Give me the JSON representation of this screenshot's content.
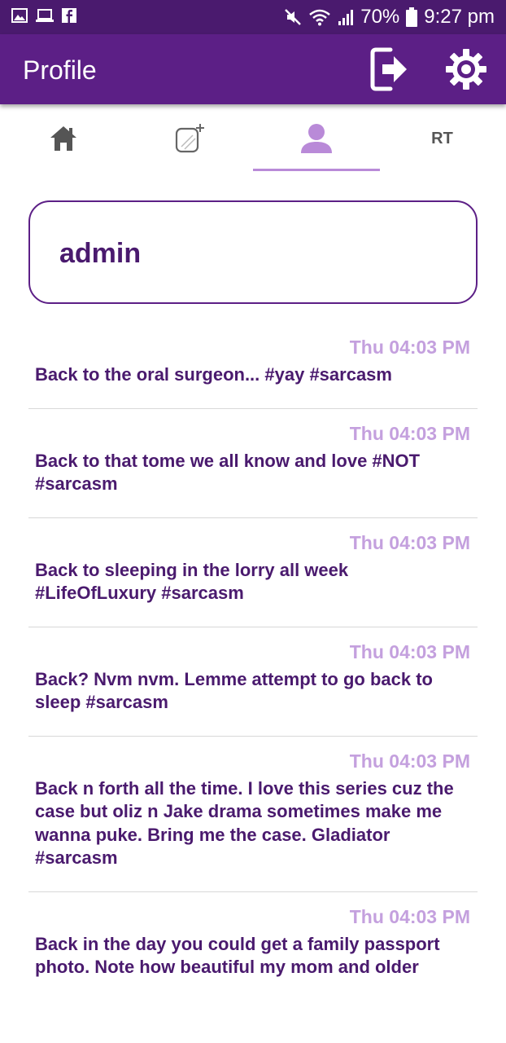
{
  "status_bar": {
    "battery": "70%",
    "time": "9:27 pm",
    "icons": [
      "gallery-icon",
      "laptop-icon",
      "facebook-icon",
      "mute-icon",
      "wifi-icon",
      "signal-icon",
      "battery-icon"
    ]
  },
  "app_bar": {
    "title": "Profile",
    "actions": [
      "logout-icon",
      "settings-icon"
    ]
  },
  "tabs": [
    {
      "icon": "home-icon"
    },
    {
      "icon": "new-post-icon"
    },
    {
      "icon": "profile-icon",
      "active": true
    },
    {
      "label": "RT"
    }
  ],
  "profile": {
    "username": "admin"
  },
  "posts": [
    {
      "time": "Thu 04:03 PM",
      "text": "Back to the oral surgeon... #yay #sarcasm"
    },
    {
      "time": "Thu 04:03 PM",
      "text": "Back to that tome we all know and love #NOT #sarcasm"
    },
    {
      "time": "Thu 04:03 PM",
      "text": "Back to sleeping in the lorry all week #LifeOfLuxury #sarcasm"
    },
    {
      "time": "Thu 04:03 PM",
      "text": "Back? Nvm nvm. Lemme attempt to go back to sleep #sarcasm"
    },
    {
      "time": "Thu 04:03 PM",
      "text": "Back n forth all the time. I love this series cuz the case but oliz n Jake drama sometimes make me wanna puke. Bring me the case. Gladiator #sarcasm"
    },
    {
      "time": "Thu 04:03 PM",
      "text": "Back in the day you could get a family passport photo. Note how beautiful my mom and older"
    }
  ],
  "colors": {
    "status_bar": "#4a1a6e",
    "app_bar": "#5c1f86",
    "accent_light": "#c4a0de",
    "text_primary": "#4a1a6e"
  }
}
